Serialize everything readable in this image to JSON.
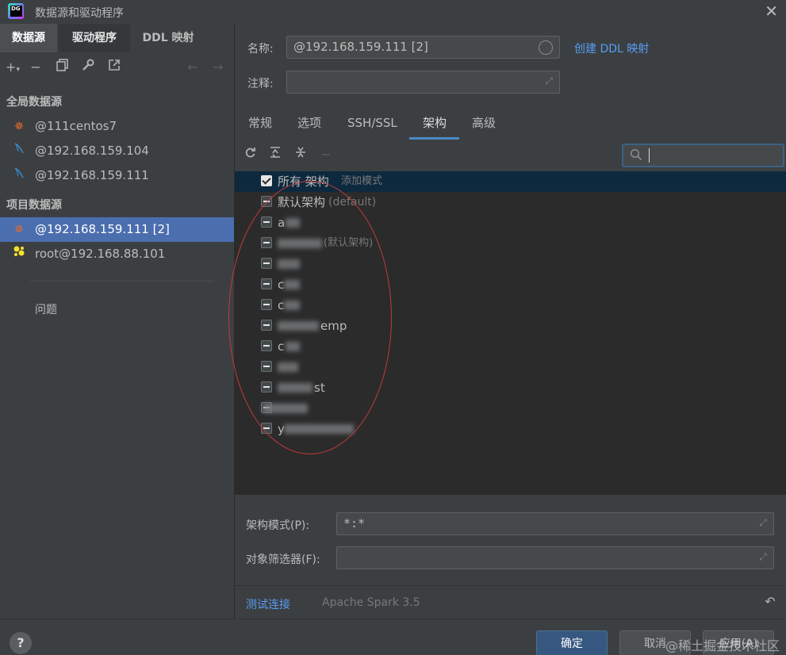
{
  "window": {
    "title": "数据源和驱动程序",
    "logo_text": "DG"
  },
  "left": {
    "tabs": [
      "数据源",
      "驱动程序",
      "DDL 映射"
    ],
    "toolbar_icons": [
      "add-icon",
      "remove-icon",
      "duplicate-icon",
      "settings-icon",
      "open-external-icon",
      "back-arrow-icon",
      "forward-arrow-icon"
    ],
    "global_section": "全局数据源",
    "global_items": [
      {
        "label": "@111centos7",
        "icon": "spark-icon",
        "color": "#e56c2b"
      },
      {
        "label": "@192.168.159.104",
        "icon": "mysql-icon",
        "color": "#3a88c7"
      },
      {
        "label": "@192.168.159.111",
        "icon": "mysql-icon",
        "color": "#3a88c7"
      }
    ],
    "project_section": "项目数据源",
    "project_items": [
      {
        "label": "@192.168.159.111 [2]",
        "icon": "spark-icon",
        "color": "#e56c2b"
      },
      {
        "label": "root@192.168.88.101",
        "icon": "clickhouse-icon",
        "color": "#f4e22a"
      }
    ],
    "problems": "问题"
  },
  "form": {
    "name_label": "名称:",
    "name_value": "@192.168.159.111 [2]",
    "ddl_link": "创建 DDL 映射",
    "comment_label": "注释:",
    "comment_value": ""
  },
  "tabs": [
    "常规",
    "选项",
    "SSH/SSL",
    "架构",
    "高级"
  ],
  "active_tab": "架构",
  "schema": {
    "toolbar_icons": [
      "refresh-icon",
      "expand-all-icon",
      "collapse-all-icon",
      "minus-icon"
    ],
    "search_placeholder": "",
    "rows": [
      {
        "name": "所有 架构",
        "hint": "添加模式",
        "state": "checked"
      },
      {
        "name": "默认架构",
        "hint": "(default)",
        "state": "partial"
      },
      {
        "name": "a",
        "hint": "",
        "state": "partial"
      },
      {
        "name": "",
        "hint": "(默认架构)",
        "state": "partial"
      },
      {
        "name": "",
        "hint": "",
        "state": "partial"
      },
      {
        "name": "c",
        "hint": "",
        "state": "partial"
      },
      {
        "name": "c",
        "hint": "",
        "state": "partial"
      },
      {
        "name": "emp",
        "hint": "",
        "state": "partial"
      },
      {
        "name": "c",
        "hint": "",
        "state": "partial"
      },
      {
        "name": "",
        "hint": "",
        "state": "partial"
      },
      {
        "name": "st",
        "hint": "",
        "state": "partial"
      },
      {
        "name": "",
        "hint": "",
        "state": "partial"
      },
      {
        "name": "y",
        "hint": "",
        "state": "partial"
      }
    ]
  },
  "bottom": {
    "schema_pattern_label": "架构模式(P):",
    "schema_pattern_value": "*:*",
    "object_filter_label": "对象筛选器(F):",
    "object_filter_value": "",
    "test_connection": "测试连接",
    "driver_version": "Apache Spark 3.5"
  },
  "footer": {
    "help": "?",
    "ok": "确定",
    "cancel": "取消",
    "apply": "应用(A)",
    "watermark": "@稀土掘金技术社区"
  }
}
